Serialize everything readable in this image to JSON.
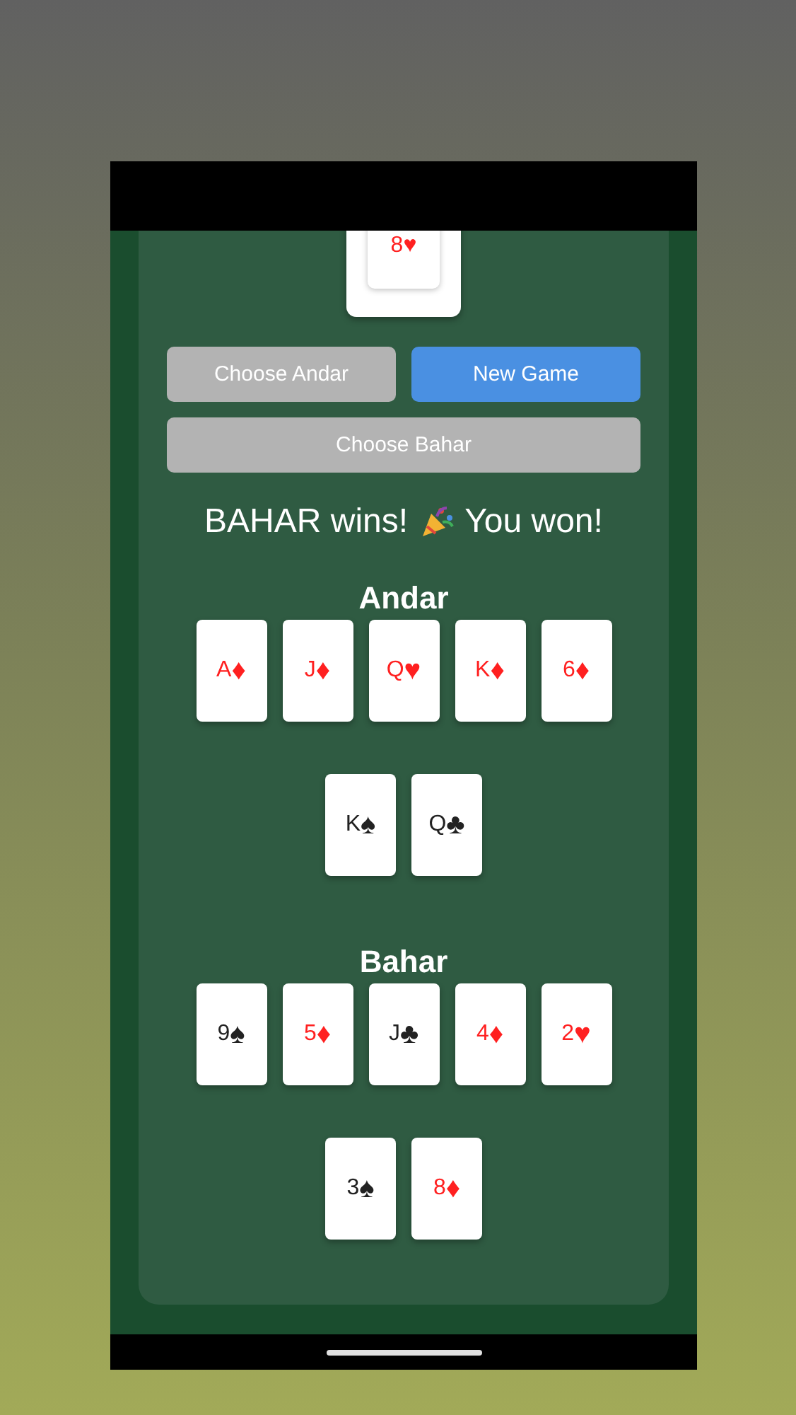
{
  "top_card": {
    "label": "8♥",
    "color": "#ff2020"
  },
  "buttons": [
    {
      "label": "Choose Andar",
      "kind": "andar",
      "disabled": true
    },
    {
      "label": "New Game",
      "kind": "new",
      "disabled": false
    },
    {
      "label": "Choose Bahar",
      "kind": "bahar",
      "disabled": true
    }
  ],
  "result": {
    "before": "BAHAR wins!",
    "after": "You won!"
  },
  "piles": [
    {
      "title": "Andar",
      "cards": [
        {
          "rank": "A",
          "suit": "♦",
          "color": "#ff2020"
        },
        {
          "rank": "J",
          "suit": "♦",
          "color": "#ff2020"
        },
        {
          "rank": "Q",
          "suit": "♥",
          "color": "#ff2020"
        },
        {
          "rank": "K",
          "suit": "♦",
          "color": "#ff2020"
        },
        {
          "rank": "6",
          "suit": "♦",
          "color": "#ff2020"
        },
        {
          "rank": "K",
          "suit": "♠",
          "color": "#222222"
        },
        {
          "rank": "Q",
          "suit": "♣",
          "color": "#222222"
        }
      ]
    },
    {
      "title": "Bahar",
      "cards": [
        {
          "rank": "9",
          "suit": "♠",
          "color": "#222222"
        },
        {
          "rank": "5",
          "suit": "♦",
          "color": "#ff2020"
        },
        {
          "rank": "J",
          "suit": "♣",
          "color": "#222222"
        },
        {
          "rank": "4",
          "suit": "♦",
          "color": "#ff2020"
        },
        {
          "rank": "2",
          "suit": "♥",
          "color": "#ff2020"
        },
        {
          "rank": "3",
          "suit": "♠",
          "color": "#222222"
        },
        {
          "rank": "8",
          "suit": "♦",
          "color": "#ff2020"
        }
      ]
    }
  ]
}
